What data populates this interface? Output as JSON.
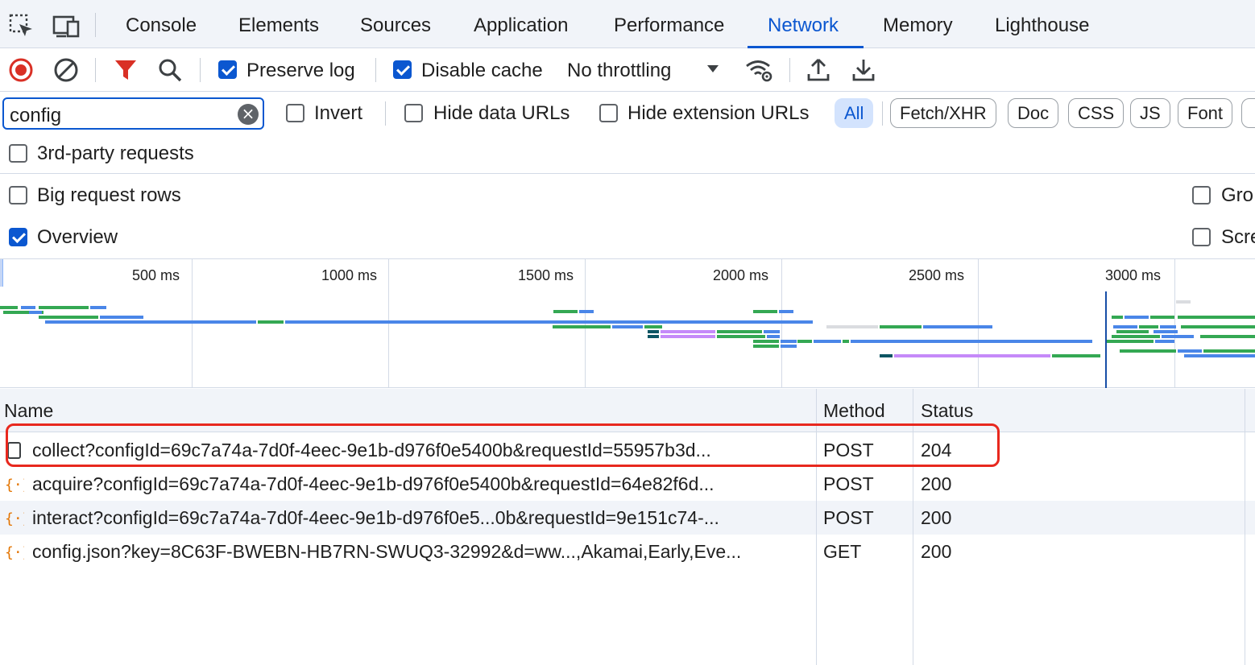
{
  "tabs": [
    {
      "label": "Console"
    },
    {
      "label": "Elements"
    },
    {
      "label": "Sources"
    },
    {
      "label": "Application"
    },
    {
      "label": "Performance"
    },
    {
      "label": "Network",
      "active": true
    },
    {
      "label": "Memory"
    },
    {
      "label": "Lighthouse"
    }
  ],
  "toolbar": {
    "preserve_log": {
      "label": "Preserve log",
      "checked": true
    },
    "disable_cache": {
      "label": "Disable cache",
      "checked": true
    },
    "throttling": "No throttling"
  },
  "filter": {
    "search_value": "config",
    "invert": {
      "label": "Invert",
      "checked": false
    },
    "hide_data_urls": {
      "label": "Hide data URLs",
      "checked": false
    },
    "hide_extension_urls": {
      "label": "Hide extension URLs",
      "checked": false
    },
    "types": [
      "All",
      "Fetch/XHR",
      "Doc",
      "CSS",
      "JS",
      "Font"
    ],
    "third_party": {
      "label": "3rd-party requests",
      "checked": false
    }
  },
  "settings": {
    "big_request_rows": {
      "label": "Big request rows",
      "checked": false
    },
    "overview": {
      "label": "Overview",
      "checked": true
    },
    "group_truncated": "Gro",
    "screenshots_truncated": "Scre"
  },
  "overview": {
    "ticks": [
      "500 ms",
      "1000 ms",
      "1500 ms",
      "2000 ms",
      "2500 ms",
      "3000 ms"
    ]
  },
  "table": {
    "columns": [
      "Name",
      "Method",
      "Status"
    ],
    "rows": [
      {
        "name": "collect?configId=69c7a74a-7d0f-4eec-9e1b-d976f0e5400b&requestId=55957b3d...",
        "method": "POST",
        "status": "204",
        "icon": "checkbox-doc-icon"
      },
      {
        "name": "acquire?configId=69c7a74a-7d0f-4eec-9e1b-d976f0e5400b&requestId=64e82f6d...",
        "method": "POST",
        "status": "200",
        "icon": "json-braces-icon"
      },
      {
        "name": "interact?configId=69c7a74a-7d0f-4eec-9e1b-d976f0e5...0b&requestId=9e151c74-...",
        "method": "POST",
        "status": "200",
        "icon": "json-braces-icon"
      },
      {
        "name": "config.json?key=8C63F-BWEBN-HB7RN-SWUQ3-32992&d=ww...,Akamai,Early,Eve...",
        "method": "GET",
        "status": "200",
        "icon": "json-braces-icon"
      }
    ]
  },
  "colors": {
    "accent": "#0b57d0",
    "highlight": "#e8281e",
    "record": "#d93025",
    "filter": "#d93025",
    "json_icon": "#e37400"
  }
}
